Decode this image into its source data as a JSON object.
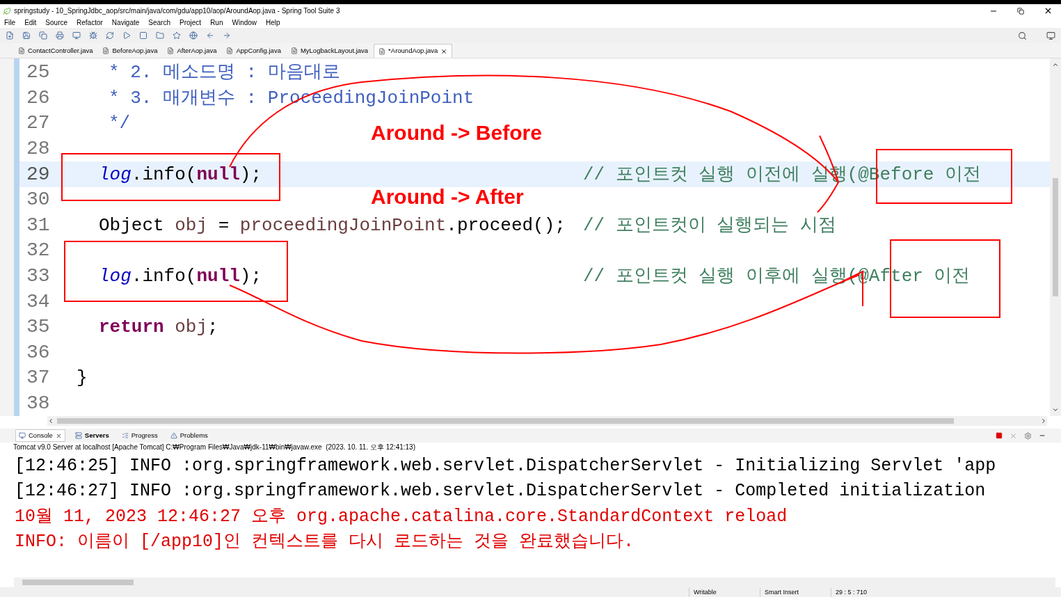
{
  "window": {
    "title": "springstudy - 10_SpringJdbc_aop/src/main/java/com/gdu/app10/aop/AroundAop.java - Spring Tool Suite 3"
  },
  "menu": [
    "File",
    "Edit",
    "Source",
    "Refactor",
    "Navigate",
    "Search",
    "Project",
    "Run",
    "Window",
    "Help"
  ],
  "editor_tabs": [
    {
      "label": "ContactController.java",
      "selected": false
    },
    {
      "label": "BeforeAop.java",
      "selected": false
    },
    {
      "label": "AfterAop.java",
      "selected": false
    },
    {
      "label": "AppConfig.java",
      "selected": false
    },
    {
      "label": "MyLogbackLayout.java",
      "selected": false
    },
    {
      "label": "*AroundAop.java",
      "selected": true
    }
  ],
  "code_lines": [
    {
      "number": "25",
      "kind": "javadoc",
      "current": false,
      "tokens": [
        {
          "kind": "doc",
          "text": "* 2. 메소드명 : 마음대로"
        }
      ]
    },
    {
      "number": "26",
      "kind": "javadoc",
      "current": false,
      "tokens": [
        {
          "kind": "doc",
          "text": "* 3. 매개변수 : ProceedingJoinPoint"
        }
      ]
    },
    {
      "number": "27",
      "kind": "javadoc",
      "current": false,
      "tokens": [
        {
          "kind": "doc",
          "text": "*/"
        }
      ]
    },
    {
      "number": "28",
      "kind": "blank",
      "current": false
    },
    {
      "number": "29",
      "kind": "statement",
      "current": true,
      "tokens": [
        {
          "kind": "field",
          "text": "log"
        },
        {
          "kind": "plain",
          "text": ".info("
        },
        {
          "kind": "keyword",
          "text": "null"
        },
        {
          "kind": "plain",
          "text": ");"
        }
      ],
      "comment": "// 포인트컷 실행 이전에 실행(@Before 이전"
    },
    {
      "number": "30",
      "kind": "blank",
      "current": false
    },
    {
      "number": "31",
      "kind": "statement",
      "current": false,
      "tokens": [
        {
          "kind": "plain",
          "text": "Object "
        },
        {
          "kind": "local",
          "text": "obj"
        },
        {
          "kind": "plain",
          "text": " = "
        },
        {
          "kind": "local",
          "text": "proceedingJoinPoint"
        },
        {
          "kind": "plain",
          "text": ".proceed();"
        }
      ],
      "comment": "// 포인트컷이 실행되는 시점"
    },
    {
      "number": "32",
      "kind": "blank",
      "current": false
    },
    {
      "number": "33",
      "kind": "statement",
      "current": false,
      "tokens": [
        {
          "kind": "field",
          "text": "log"
        },
        {
          "kind": "plain",
          "text": ".info("
        },
        {
          "kind": "keyword",
          "text": "null"
        },
        {
          "kind": "plain",
          "text": ");"
        }
      ],
      "comment": "// 포인트컷 실행 이후에 실행(@After 이전"
    },
    {
      "number": "34",
      "kind": "blank",
      "current": false
    },
    {
      "number": "35",
      "kind": "statement",
      "current": false,
      "tokens": [
        {
          "kind": "keyword",
          "text": "return"
        },
        {
          "kind": "local",
          "text": " obj"
        },
        {
          "kind": "plain",
          "text": ";"
        }
      ]
    },
    {
      "number": "36",
      "kind": "blank",
      "current": false
    },
    {
      "number": "37",
      "kind": "brace",
      "current": false,
      "tokens": [
        {
          "kind": "plain",
          "text": "}"
        }
      ]
    },
    {
      "number": "38",
      "kind": "blank",
      "current": false
    }
  ],
  "annotations": [
    {
      "text": "Around -> Before"
    },
    {
      "text": "Around -> After"
    }
  ],
  "console_tabs": [
    {
      "label": "Console",
      "selected": true
    },
    {
      "label": "Servers",
      "selected": false
    },
    {
      "label": "Progress",
      "selected": false
    },
    {
      "label": "Problems",
      "selected": false
    }
  ],
  "console": {
    "header": "Tomcat v9.0 Server at localhost [Apache Tomcat] C:₩Program Files₩Java₩jdk-11₩bin₩javaw.exe  (2023. 10. 11. 오후 12:41:13)",
    "lines": [
      {
        "kind": "stdout",
        "text": "[12:46:25] INFO :org.springframework.web.servlet.DispatcherServlet - Initializing Servlet 'app"
      },
      {
        "kind": "stdout",
        "text": "[12:46:27] INFO :org.springframework.web.servlet.DispatcherServlet - Completed initialization"
      },
      {
        "kind": "stderr",
        "text": "10월 11, 2023 12:46:27 오후 org.apache.catalina.core.StandardContext reload"
      },
      {
        "kind": "stderr",
        "text": "INFO: 이름이 [/app10]인 컨텍스트를 다시 로드하는 것을 완료했습니다."
      }
    ]
  },
  "status_bar": [
    "Writable",
    "Smart Insert",
    "29 : 5 : 710"
  ]
}
